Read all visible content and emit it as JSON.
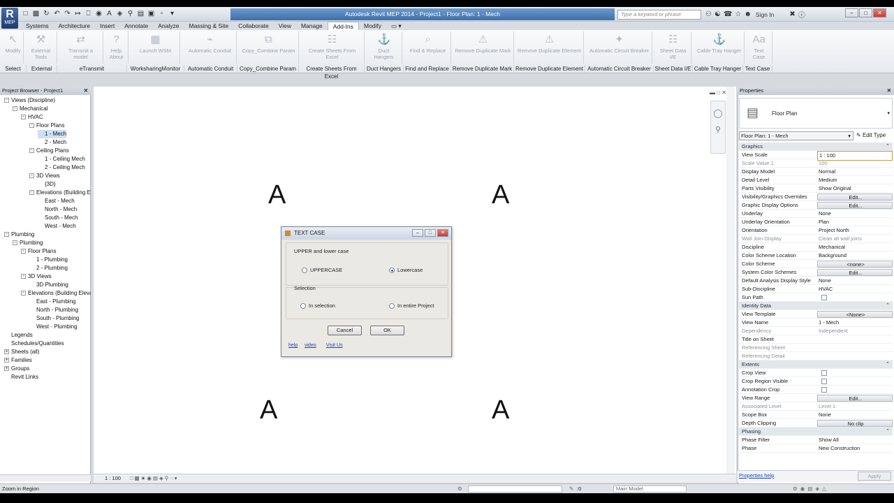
{
  "app": {
    "title": "Autodesk Revit MEP 2014 -    Project1 - Floor Plan: 1 - Mech",
    "logo_letter": "R",
    "logo_sub": "MEP",
    "search_placeholder": "Type a keyword or phrase",
    "sign_in": "Sign In"
  },
  "tabs": [
    "Systems",
    "Architecture",
    "Insert",
    "Annotate",
    "Analyze",
    "Massing & Site",
    "Collaborate",
    "View",
    "Manage",
    "Add-Ins",
    "Modify"
  ],
  "active_tab": "Add-Ins",
  "ribbon": {
    "buttons": [
      "Modify",
      "External Tools",
      "Transmit a model",
      "Help",
      "About",
      "Launch WSM",
      "Automatic Conduit",
      "Copy_Combine Param",
      "Create Sheets From Excel",
      "Duct Hangers",
      "Find & Replace",
      "Remove Duplicate Mark",
      "Remove Duplicate Element",
      "Automatic Circuit Breaker",
      "Sheet Data I/E",
      "Cable Tray Hanger",
      "Text Case"
    ],
    "panels": [
      "Select",
      "External",
      "eTransmit",
      "WorksharingMonitor",
      "Automatic Conduit",
      "Copy_Combine Param",
      "Create Sheets From Excel",
      "Duct Hangers",
      "Find and Replace",
      "Remove Duplicate Mark",
      "Remove Duplicate Element",
      "Automatic Circuit Breaker",
      "Sheet Data I/E",
      "Cable Tray Hanger",
      "Text Case"
    ]
  },
  "project_browser": {
    "title": "Project Browser - Project1",
    "tree": [
      {
        "label": "Views (Discipline)",
        "toggle": "-"
      },
      {
        "label": "Mechanical",
        "toggle": "-"
      },
      {
        "label": "HVAC",
        "toggle": "-"
      },
      {
        "label": "Floor Plans",
        "toggle": "-"
      },
      {
        "label": "1 - Mech",
        "toggle": "",
        "selected": true
      },
      {
        "label": "2 - Mech",
        "toggle": ""
      },
      {
        "label": "Ceiling Plans",
        "toggle": "-"
      },
      {
        "label": "1 - Ceiling Mech",
        "toggle": ""
      },
      {
        "label": "2 - Ceiling Mech",
        "toggle": ""
      },
      {
        "label": "3D Views",
        "toggle": "-"
      },
      {
        "label": "{3D}",
        "toggle": ""
      },
      {
        "label": "Elevations (Building Elevation)",
        "toggle": "-"
      },
      {
        "label": "East - Mech",
        "toggle": ""
      },
      {
        "label": "North - Mech",
        "toggle": ""
      },
      {
        "label": "South - Mech",
        "toggle": ""
      },
      {
        "label": "West - Mech",
        "toggle": ""
      },
      {
        "label": "Plumbing",
        "toggle": "-"
      },
      {
        "label": "Plumbing",
        "toggle": "-"
      },
      {
        "label": "Floor Plans",
        "toggle": "-"
      },
      {
        "label": "1 - Plumbing",
        "toggle": ""
      },
      {
        "label": "2 - Plumbing",
        "toggle": ""
      },
      {
        "label": "3D Views",
        "toggle": "-"
      },
      {
        "label": "3D Plumbing",
        "toggle": ""
      },
      {
        "label": "Elevations (Building Elevation)",
        "toggle": "-"
      },
      {
        "label": "East - Plumbing",
        "toggle": ""
      },
      {
        "label": "North - Plumbing",
        "toggle": ""
      },
      {
        "label": "South - Plumbing",
        "toggle": ""
      },
      {
        "label": "West - Plumbing",
        "toggle": ""
      },
      {
        "label": "Legends",
        "toggle": ""
      },
      {
        "label": "Schedules/Quantities",
        "toggle": ""
      },
      {
        "label": "Sheets (all)",
        "toggle": "+"
      },
      {
        "label": "Families",
        "toggle": "+"
      },
      {
        "label": "Groups",
        "toggle": "+"
      },
      {
        "label": "Revit Links",
        "toggle": ""
      }
    ]
  },
  "canvas": {
    "marks": [
      "A",
      "A",
      "A",
      "A"
    ]
  },
  "view_control": {
    "scale": "1 : 100"
  },
  "dialog": {
    "title": "TEXT CASE",
    "group1_label": "UPPER and lower case",
    "opt_upper": "UPPERCASE",
    "opt_lower": "Lowercase",
    "group2_label": "Selection",
    "opt_selection": "In selection",
    "opt_project": "In entire Project",
    "cancel": "Cancel",
    "ok": "OK",
    "link_help": "help",
    "link_video": "video",
    "link_visit": "Visit Us"
  },
  "properties": {
    "title": "Properties",
    "type_name": "Floor Plan",
    "instance_selector": "Floor Plan: 1 - Mech",
    "edit_type": "Edit Type",
    "help_link": "Properties help",
    "apply": "Apply",
    "rows": [
      {
        "k": "Graphics",
        "section": true
      },
      {
        "k": "View Scale",
        "v": "1 : 100",
        "hl": true
      },
      {
        "k": "Scale Value    1:",
        "v": "100",
        "dim": true
      },
      {
        "k": "Display Model",
        "v": "Normal"
      },
      {
        "k": "Detail Level",
        "v": "Medium"
      },
      {
        "k": "Parts Visibility",
        "v": "Show Original"
      },
      {
        "k": "Visibility/Graphics Overrides",
        "v": "Edit...",
        "btn": true
      },
      {
        "k": "Graphic Display Options",
        "v": "Edit...",
        "btn": true
      },
      {
        "k": "Underlay",
        "v": "None"
      },
      {
        "k": "Underlay Orientation",
        "v": "Plan"
      },
      {
        "k": "Orientation",
        "v": "Project North"
      },
      {
        "k": "Wall Join Display",
        "v": "Clean all wall joins",
        "dim": true
      },
      {
        "k": "Discipline",
        "v": "Mechanical"
      },
      {
        "k": "Color Scheme Location",
        "v": "Background"
      },
      {
        "k": "Color Scheme",
        "v": "<none>",
        "btn": true
      },
      {
        "k": "System Color Schemes",
        "v": "Edit...",
        "btn": true
      },
      {
        "k": "Default Analysis Display Style",
        "v": "None"
      },
      {
        "k": "Sub-Discipline",
        "v": "HVAC"
      },
      {
        "k": "Sun Path",
        "v": "",
        "chk": true
      },
      {
        "k": "Identity Data",
        "section": true
      },
      {
        "k": "View Template",
        "v": "<None>",
        "btn": true
      },
      {
        "k": "View Name",
        "v": "1 - Mech"
      },
      {
        "k": "Dependency",
        "v": "Independent",
        "dim": true
      },
      {
        "k": "Title on Sheet",
        "v": ""
      },
      {
        "k": "Referencing Sheet",
        "v": "",
        "dim": true
      },
      {
        "k": "Referencing Detail",
        "v": "",
        "dim": true
      },
      {
        "k": "Extents",
        "section": true
      },
      {
        "k": "Crop View",
        "v": "",
        "chk": true
      },
      {
        "k": "Crop Region Visible",
        "v": "",
        "chk": true
      },
      {
        "k": "Annotation Crop",
        "v": "",
        "chk": true
      },
      {
        "k": "View Range",
        "v": "Edit...",
        "btn": true
      },
      {
        "k": "Associated Level",
        "v": "Level 1",
        "dim": true
      },
      {
        "k": "Scope Box",
        "v": "None"
      },
      {
        "k": "Depth Clipping",
        "v": "No clip",
        "btn": true
      },
      {
        "k": "Phasing",
        "section": true
      },
      {
        "k": "Phase Filter",
        "v": "Show All"
      },
      {
        "k": "Phase",
        "v": "New Construction"
      }
    ]
  },
  "status": {
    "text": "Zoom in Region",
    "count": ":0",
    "model": "Main Model"
  }
}
